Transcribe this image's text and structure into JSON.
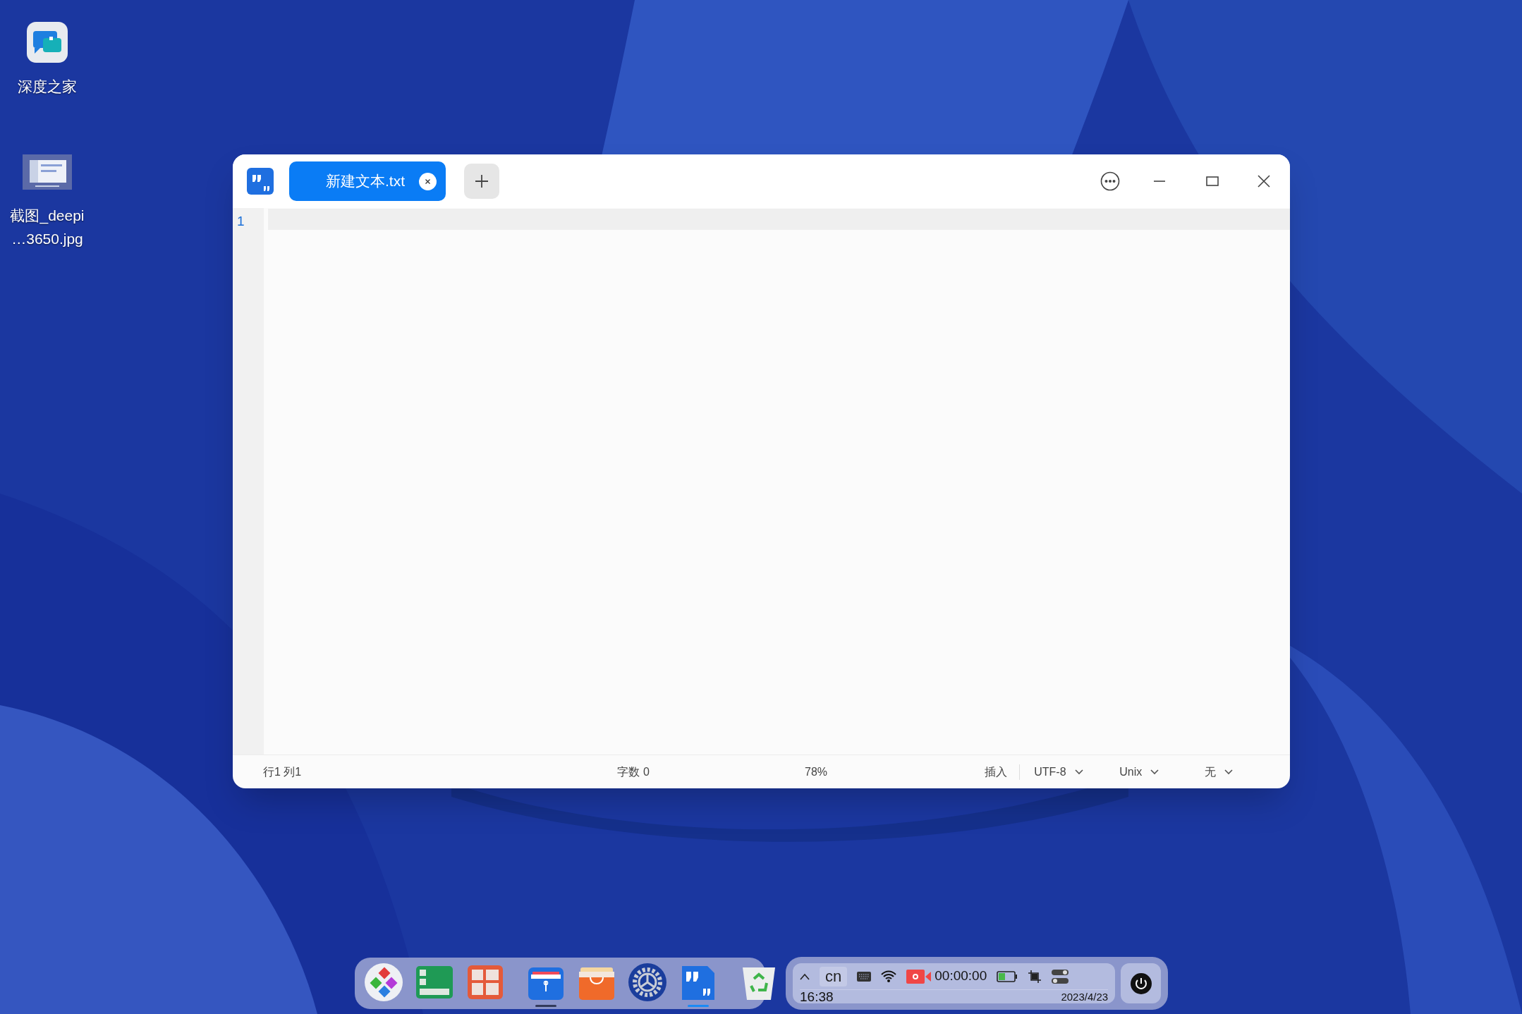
{
  "desktop_icons": [
    {
      "kind": "app",
      "lines": [
        "深度之家"
      ]
    },
    {
      "lines": [
        "截图_deepi",
        "…3650.jpg"
      ]
    }
  ],
  "window": {
    "tabs": [
      {
        "label": "新建文本.txt",
        "selected": true
      }
    ],
    "editor": {
      "line_numbers": [
        "1"
      ]
    },
    "status_bar": {
      "position": "行1 列1",
      "word_count": "字数 0",
      "zoom": "78%",
      "mode": "插入",
      "dropdowns": [
        "UTF-8",
        "Unix",
        "无"
      ]
    }
  },
  "dock": [
    {
      "kind": "launcher",
      "running": false,
      "focused": false
    },
    {
      "kind": "monitor",
      "running": false,
      "focused": false
    },
    {
      "kind": "grid",
      "running": false,
      "focused": false
    },
    {
      "kind": "separator"
    },
    {
      "kind": "files",
      "running": true,
      "focused": false
    },
    {
      "kind": "store",
      "running": false,
      "focused": false
    },
    {
      "kind": "settings",
      "running": false,
      "focused": false
    },
    {
      "kind": "editor",
      "running": true,
      "focused": true
    },
    {
      "kind": "separator"
    },
    {
      "kind": "trash",
      "running": false,
      "focused": false
    }
  ],
  "tray": {
    "input_method": "cn",
    "recording_time": "00:00:00",
    "time": "16:38",
    "date": "2023/4/23"
  }
}
